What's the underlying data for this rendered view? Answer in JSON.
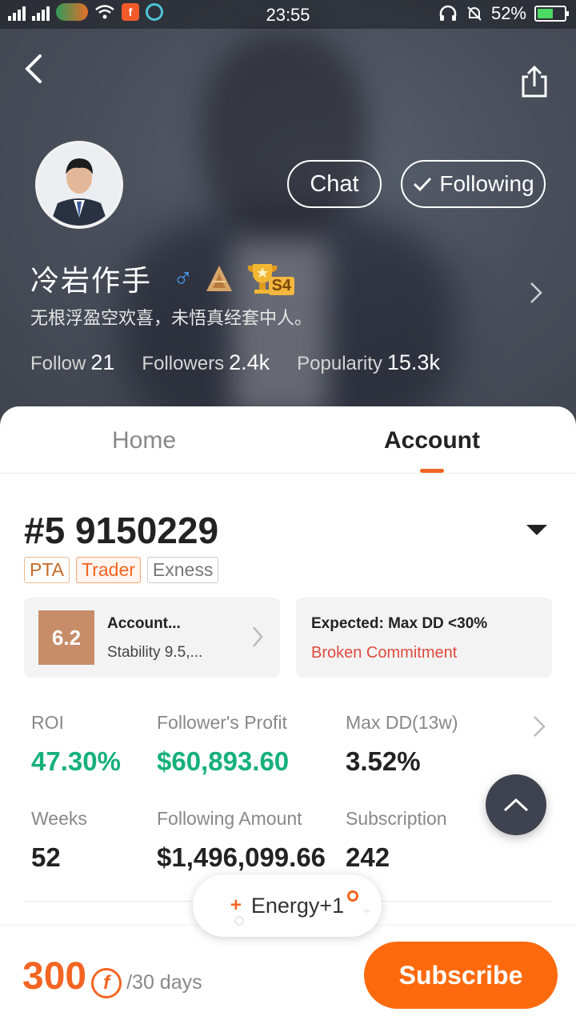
{
  "status_bar": {
    "time": "23:55",
    "battery": "52%"
  },
  "profile": {
    "name": "冷岩作手",
    "gender_symbol": "♂",
    "rank_badge": "S4",
    "bio": "无根浮盈空欢喜，未悟真经套中人。",
    "chat_label": "Chat",
    "following_label": "Following",
    "stats": {
      "follow_label": "Follow",
      "follow_value": "21",
      "followers_label": "Followers",
      "followers_value": "2.4k",
      "popularity_label": "Popularity",
      "popularity_value": "15.3k"
    }
  },
  "tabs": {
    "home": "Home",
    "account": "Account"
  },
  "account": {
    "title": "#5 9150229",
    "tags": [
      "PTA",
      "Trader",
      "Exness"
    ],
    "score": "6.2",
    "rating_title": "Account...",
    "rating_sub": "Stability 9.5,...",
    "expected_title": "Expected: Max DD <30%",
    "expected_status": "Broken Commitment",
    "metrics": {
      "roi_label": "ROI",
      "roi_value": "47.30%",
      "follower_profit_label": "Follower's Profit",
      "follower_profit_value": "$60,893.60",
      "maxdd_label": "Max DD(13w)",
      "maxdd_value": "3.52%",
      "weeks_label": "Weeks",
      "weeks_value": "52",
      "following_amount_label": "Following Amount",
      "following_amount_value": "$1,496,099.66",
      "subscription_label": "Subscription",
      "subscription_value": "242"
    }
  },
  "toast": {
    "plus": "+",
    "text": "Energy+1"
  },
  "footer": {
    "price": "300",
    "currency_symbol": "f",
    "period": "/30 days",
    "subscribe_label": "Subscribe"
  },
  "colors": {
    "accent": "#f26522",
    "positive": "#16b07a",
    "warning": "#e04a3c",
    "male": "#4a9cf0"
  }
}
